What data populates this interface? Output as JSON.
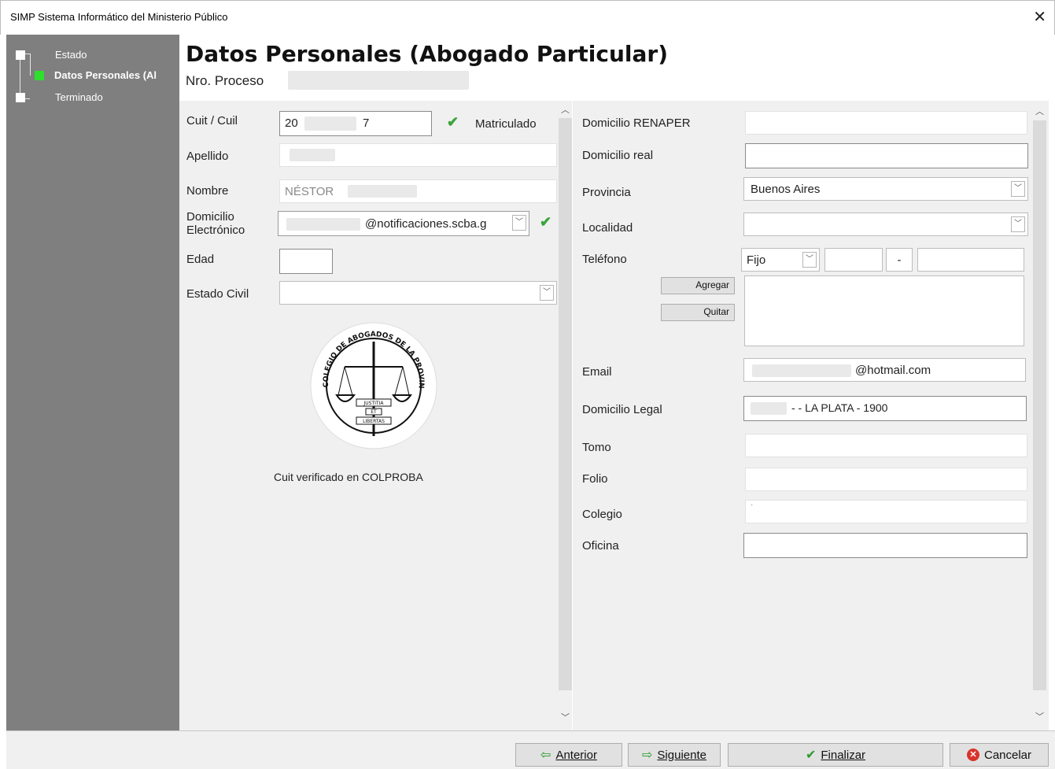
{
  "window": {
    "title": "SIMP Sistema Informático del Ministerio Público",
    "close": "✕"
  },
  "steps": [
    {
      "label": "Estado"
    },
    {
      "label": "Datos Personales (Al"
    },
    {
      "label": "Terminado"
    }
  ],
  "header": {
    "title": "Datos Personales (Abogado Particular)",
    "proceso_label": "Nro. Proceso"
  },
  "left": {
    "cuit_label": "Cuit / Cuil",
    "cuit_value": "20",
    "cuit_suffix": "7",
    "matriculado": "Matriculado",
    "apellido_label": "Apellido",
    "nombre_label": "Nombre",
    "nombre_value": "NÉSTOR",
    "domicilio_elec_label_1": "Domicilio",
    "domicilio_elec_label_2": "Electrónico",
    "domicilio_elec_value": "@notificaciones.scba.g",
    "edad_label": "Edad",
    "estado_civil_label": "Estado Civil",
    "seal_top": "COLEGIO DE ABOGADOS DE LA PROVINCIA DE BUENOS AIRES",
    "seal_center_1": "JUSTITIA",
    "seal_center_2": "ET",
    "seal_center_3": "LIBERTAS",
    "colproba": "Cuit verificado en COLPROBA"
  },
  "right": {
    "renaper_label": "Domicilio RENAPER",
    "real_label": "Domicilio real",
    "provincia_label": "Provincia",
    "provincia_value": "Buenos Aires",
    "localidad_label": "Localidad",
    "telefono_label": "Teléfono",
    "telefono_tipo": "Fijo",
    "telefono_sep": "-",
    "agregar": "Agregar",
    "quitar": "Quitar",
    "email_label": "Email",
    "email_value": "@hotmail.com",
    "legal_label": "Domicilio Legal",
    "legal_value": "- - LA PLATA - 1900",
    "tomo_label": "Tomo",
    "folio_label": "Folio",
    "colegio_label": "Colegio",
    "colegio_value": "·",
    "oficina_label": "Oficina"
  },
  "footer": {
    "anterior": "Anterior",
    "siguiente": "Siguiente",
    "finalizar": "Finalizar",
    "cancelar": "Cancelar"
  }
}
